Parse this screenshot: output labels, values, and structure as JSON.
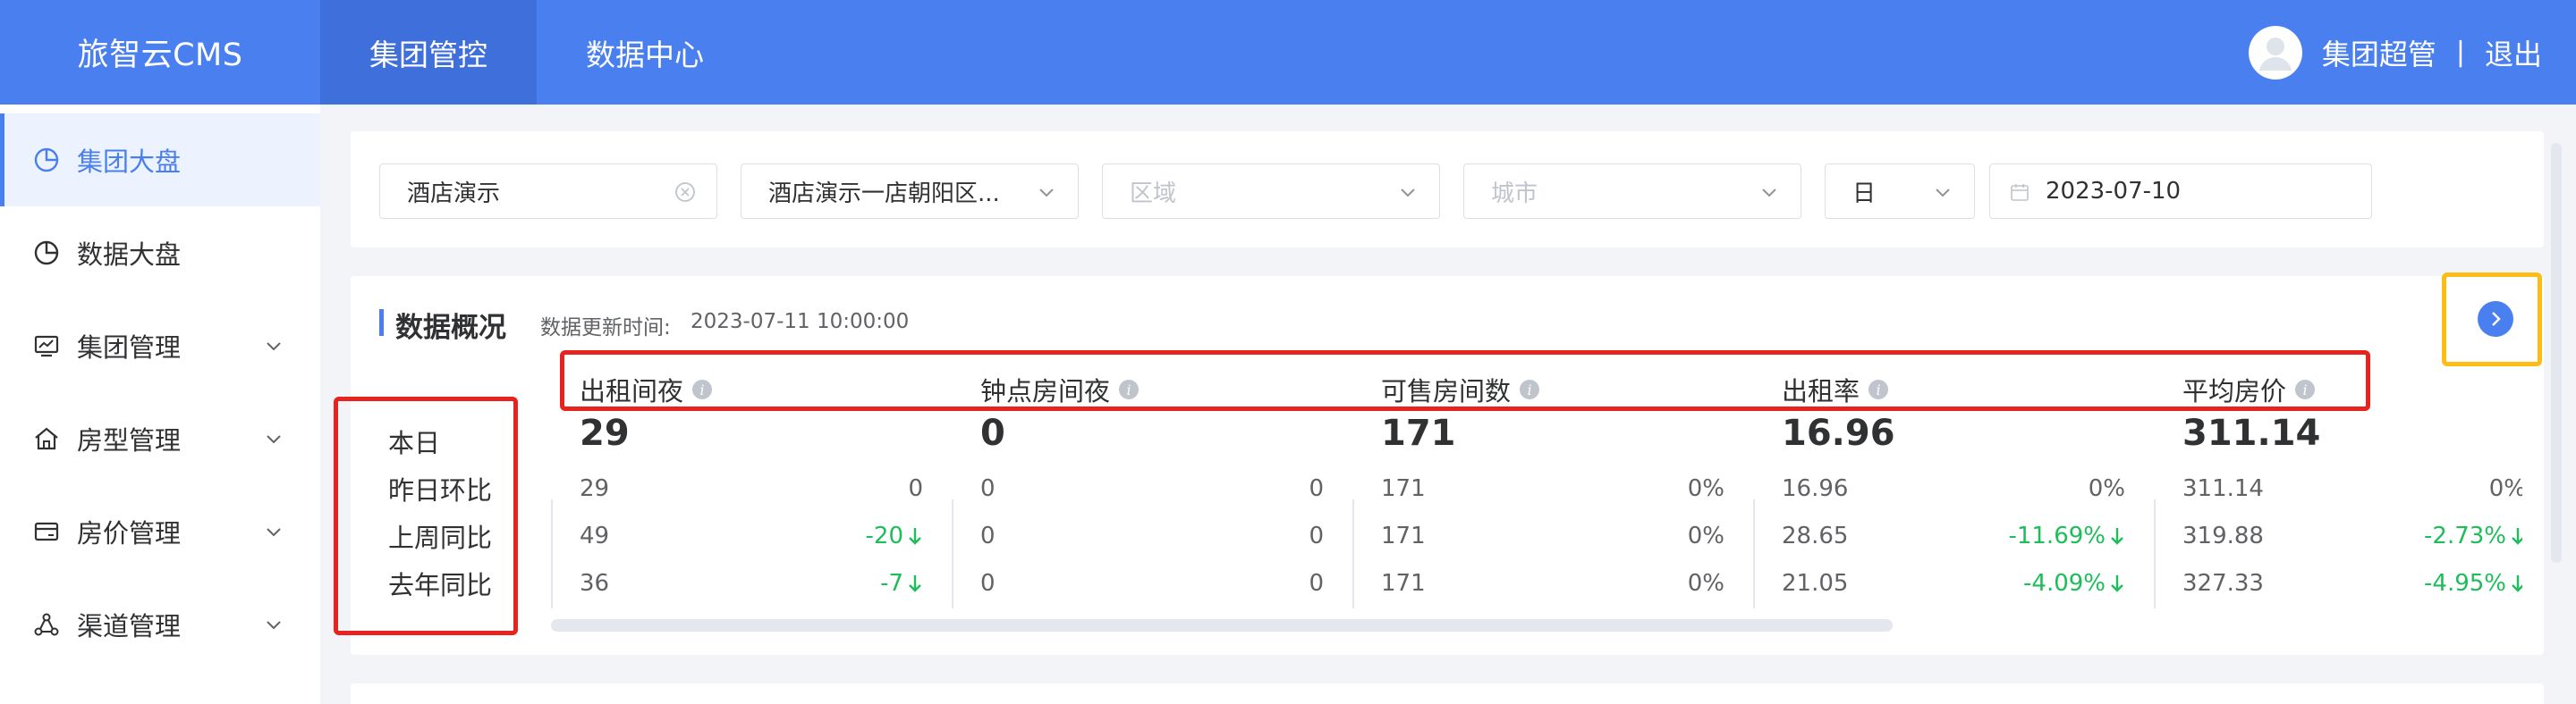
{
  "header": {
    "logo": "旅智云CMS",
    "nav": [
      {
        "label": "集团管控",
        "active": true
      },
      {
        "label": "数据中心",
        "active": false
      }
    ],
    "user": {
      "name": "集团超管",
      "separator": "|",
      "logout": "退出"
    }
  },
  "sidebar": {
    "items": [
      {
        "label": "集团大盘",
        "icon": "pie-chart-icon",
        "active": true,
        "expandable": false
      },
      {
        "label": "数据大盘",
        "icon": "pie-chart-icon",
        "active": false,
        "expandable": false
      },
      {
        "label": "集团管理",
        "icon": "monitor-chart-icon",
        "active": false,
        "expandable": true
      },
      {
        "label": "房型管理",
        "icon": "home-icon",
        "active": false,
        "expandable": true
      },
      {
        "label": "房价管理",
        "icon": "card-icon",
        "active": false,
        "expandable": true
      },
      {
        "label": "渠道管理",
        "icon": "network-icon",
        "active": false,
        "expandable": true
      }
    ]
  },
  "filters": {
    "hotel": {
      "value": "酒店演示"
    },
    "store": {
      "value": "酒店演示一店朝阳区..."
    },
    "region": {
      "placeholder": "区域"
    },
    "city": {
      "placeholder": "城市"
    },
    "period": {
      "value": "日"
    },
    "date": {
      "value": "2023-07-10"
    }
  },
  "overview": {
    "title": "数据概况",
    "update_label": "数据更新时间:",
    "update_time": "2023-07-11 10:00:00",
    "row_labels": [
      "本日",
      "昨日环比",
      "上周同比",
      "去年同比"
    ],
    "columns": [
      {
        "header": "出租间夜",
        "today": "29",
        "rows": [
          {
            "value": "29",
            "change": "0",
            "down": false
          },
          {
            "value": "49",
            "change": "-20",
            "down": true
          },
          {
            "value": "36",
            "change": "-7",
            "down": true
          }
        ]
      },
      {
        "header": "钟点房间夜",
        "today": "0",
        "rows": [
          {
            "value": "0",
            "change": "0",
            "down": false
          },
          {
            "value": "0",
            "change": "0",
            "down": false
          },
          {
            "value": "0",
            "change": "0",
            "down": false
          }
        ]
      },
      {
        "header": "可售房间数",
        "today": "171",
        "rows": [
          {
            "value": "171",
            "change": "0%",
            "down": false
          },
          {
            "value": "171",
            "change": "0%",
            "down": false
          },
          {
            "value": "171",
            "change": "0%",
            "down": false
          }
        ]
      },
      {
        "header": "出租率",
        "today": "16.96",
        "rows": [
          {
            "value": "16.96",
            "change": "0%",
            "down": false
          },
          {
            "value": "28.65",
            "change": "-11.69%",
            "down": true
          },
          {
            "value": "21.05",
            "change": "-4.09%",
            "down": true
          }
        ]
      },
      {
        "header": "平均房价",
        "today": "311.14",
        "rows": [
          {
            "value": "311.14",
            "change": "0%",
            "down": false
          },
          {
            "value": "319.88",
            "change": "-2.73%",
            "down": true
          },
          {
            "value": "327.33",
            "change": "-4.95%",
            "down": true
          }
        ]
      }
    ]
  },
  "colors": {
    "brand": "#4a7ff0",
    "positive_down": "#1dbe5a",
    "annotation_red": "#e8221d",
    "annotation_yellow": "#fbbd16"
  }
}
